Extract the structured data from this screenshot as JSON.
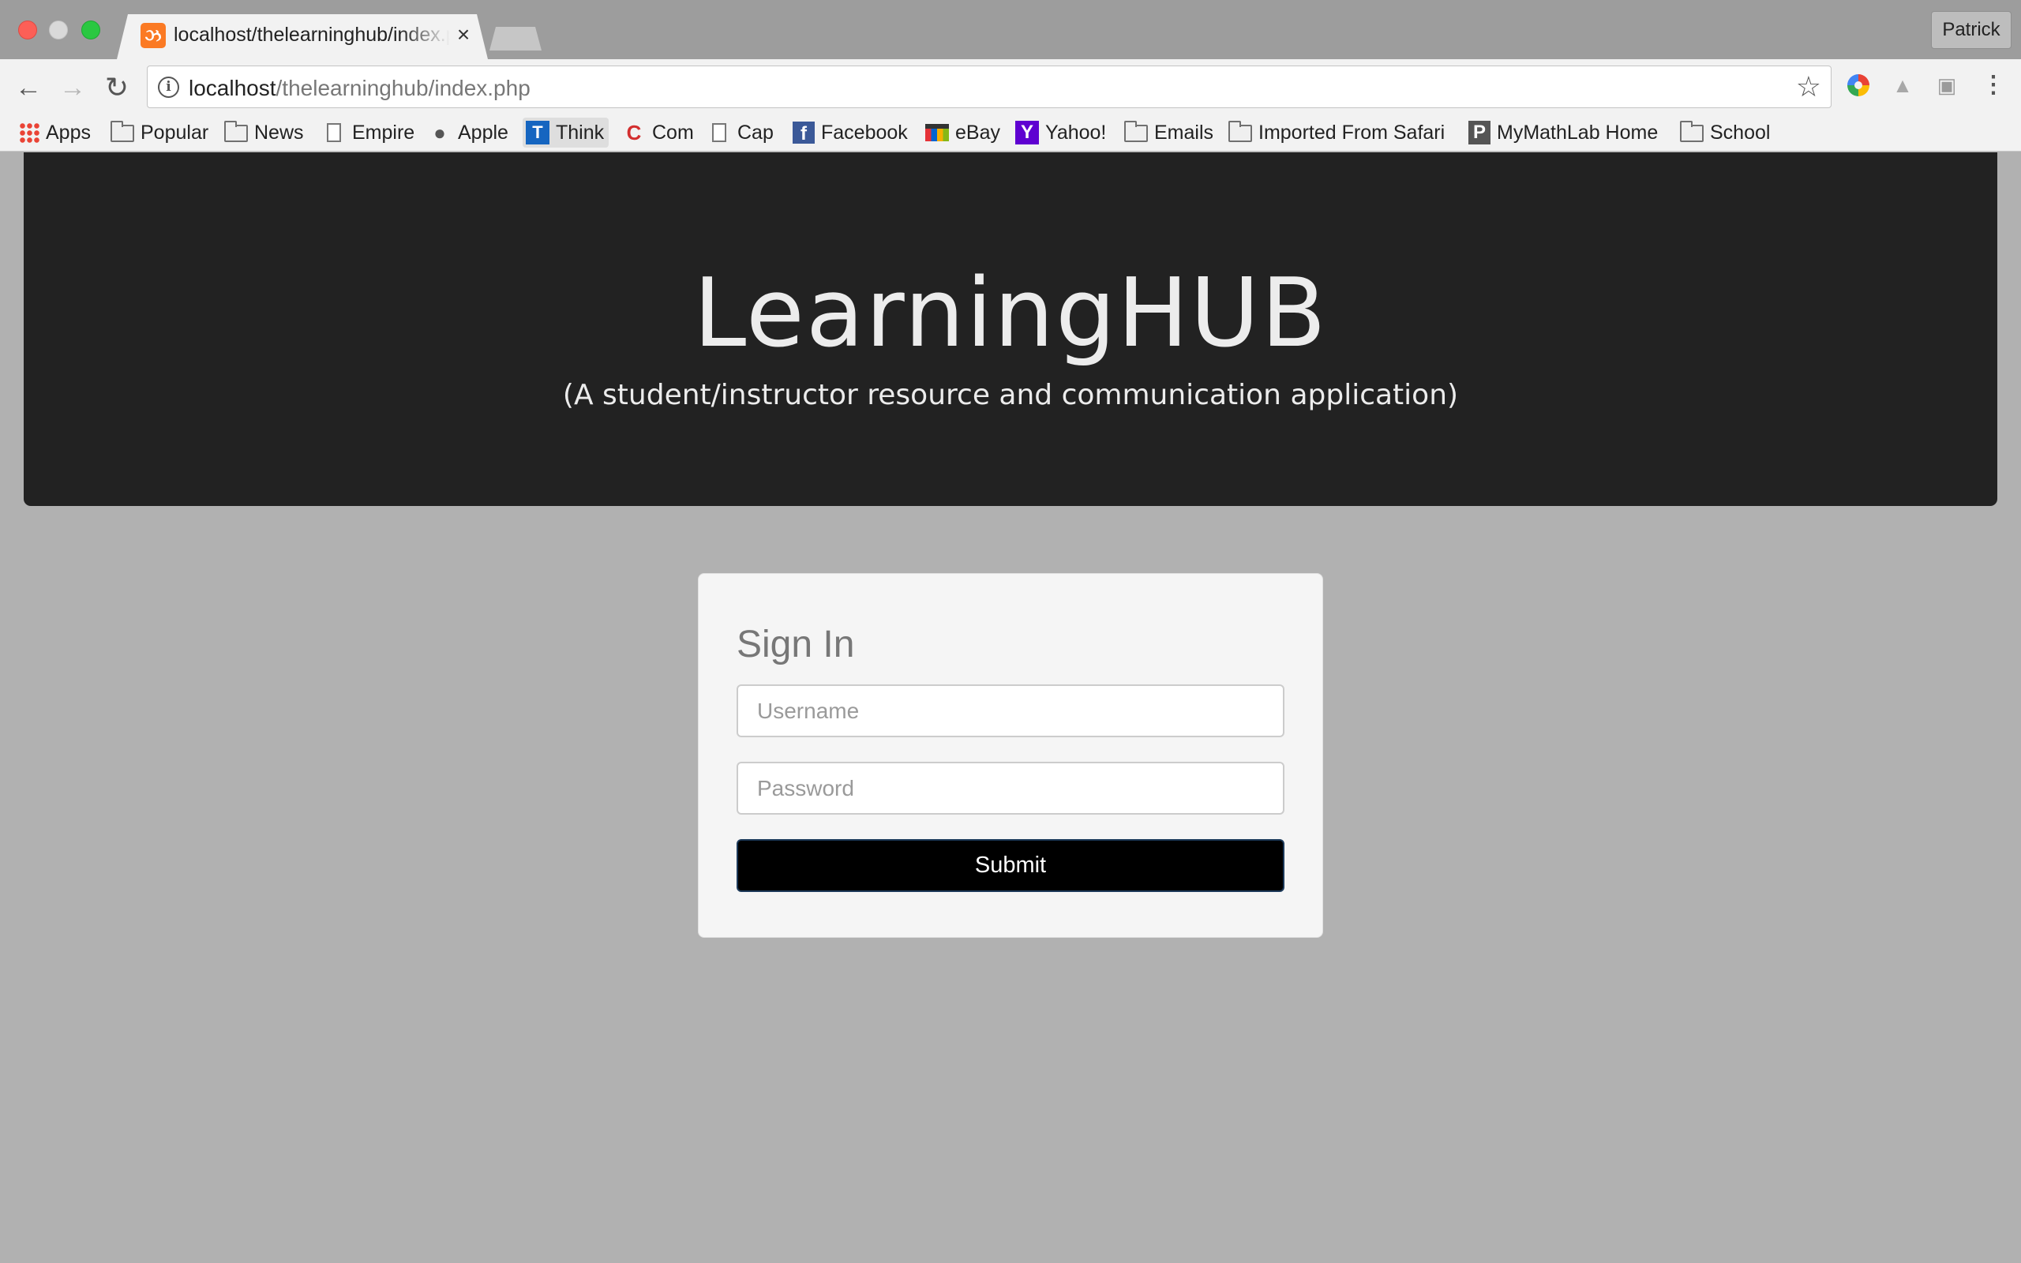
{
  "browser": {
    "tab": {
      "title": "localhost/thelearninghub/index.php",
      "favicon": "xampp-icon"
    },
    "profile_name": "Patrick",
    "address": {
      "host": "localhost",
      "path": "/thelearninghub/index.php"
    },
    "bookmarks": [
      {
        "label": "Apps",
        "icon": "apps-grid-icon"
      },
      {
        "label": "Popular",
        "icon": "folder-icon"
      },
      {
        "label": "News",
        "icon": "folder-icon"
      },
      {
        "label": "Empire",
        "icon": "page-icon"
      },
      {
        "label": "Apple",
        "icon": "apple-icon"
      },
      {
        "label": "Think",
        "icon": "think-icon"
      },
      {
        "label": "Com",
        "icon": "com-icon"
      },
      {
        "label": "Cap",
        "icon": "page-icon"
      },
      {
        "label": "Facebook",
        "icon": "facebook-icon"
      },
      {
        "label": "eBay",
        "icon": "ebay-icon"
      },
      {
        "label": "Yahoo!",
        "icon": "yahoo-icon"
      },
      {
        "label": "Emails",
        "icon": "folder-icon"
      },
      {
        "label": "Imported From Safari",
        "icon": "folder-icon"
      },
      {
        "label": "MyMathLab Home",
        "icon": "mymathlab-icon"
      },
      {
        "label": "School",
        "icon": "folder-icon"
      }
    ]
  },
  "hero": {
    "title": "LearningHUB",
    "subtitle": "(A student/instructor resource and communication application)",
    "background": "#222222"
  },
  "signin": {
    "heading": "Sign In",
    "username": {
      "placeholder": "Username",
      "value": ""
    },
    "password": {
      "placeholder": "Password",
      "value": ""
    },
    "submit_label": "Submit"
  }
}
